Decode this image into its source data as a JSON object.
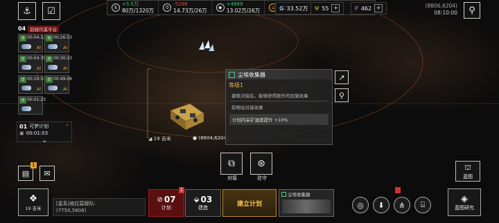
{
  "top_left_buttons": [
    {
      "name": "fleet-anchor-icon",
      "glyph": "⚓"
    },
    {
      "name": "task-list-icon",
      "glyph": "☑"
    }
  ],
  "resources": [
    {
      "icon": "credits-icon",
      "glyph": "$",
      "delta": "+5.5万",
      "delta_type": "inc",
      "amount": "80万/1320万"
    },
    {
      "icon": "metal-icon",
      "glyph": "0",
      "delta": "-5288",
      "delta_type": "dec",
      "amount": "14.73万/26万"
    },
    {
      "icon": "crystal-icon",
      "glyph": "◆",
      "delta": "+4889",
      "delta_type": "inc",
      "amount": "13.02万/26万"
    },
    {
      "icon": "fuel-icon",
      "glyph": "⌂",
      "delta": "",
      "delta_type": "",
      "amount": "121"
    }
  ],
  "resources2": [
    {
      "icon": "gas-icon",
      "glyph": "G",
      "value": "33.52万",
      "color": "#8fb3d9"
    },
    {
      "icon": "gold-icon",
      "glyph": "Ψ",
      "value": "55",
      "color": "#e0c040"
    },
    {
      "icon": "premium-icon",
      "glyph": "P",
      "value": "462",
      "color": "#b57ee0"
    }
  ],
  "coords_time": {
    "coords": "(8806,6204)",
    "time": "08:10:00"
  },
  "queue": {
    "number": "04",
    "label": "前線作業平台",
    "slots": [
      {
        "time": "00:04:13"
      },
      {
        "time": "00:26:53"
      },
      {
        "time": "00:04:39"
      },
      {
        "time": "00:30:23"
      },
      {
        "time": "00:29:53"
      },
      {
        "time": "00:49:06"
      },
      {
        "time": "00:01:23"
      }
    ],
    "slot_tag": "AI"
  },
  "plan": {
    "number": "01",
    "title": "可梦计划",
    "time": "00:01:03"
  },
  "map_labels": {
    "distance_left": "19 吉米",
    "coords_mid": "(8804,6204)"
  },
  "info_panel": {
    "title": "尘埃收集器",
    "level": "等级1",
    "desc1": "建筑对接后，能够获得额外的设施效果",
    "desc2": "前哨站对接效果",
    "effect": "计划内采矿速度提升 +10%"
  },
  "actions": [
    {
      "name": "dock-button",
      "label": "对接",
      "glyph": "⧉"
    },
    {
      "name": "garrison-button",
      "label": "驻守",
      "glyph": "⊛"
    }
  ],
  "right_side_buttons": [
    {
      "name": "share-icon",
      "glyph": "↗"
    },
    {
      "name": "pin-icon",
      "glyph": "⚲"
    }
  ],
  "blueprint_button": {
    "label": "蓝图"
  },
  "bottom": {
    "location_label": "[星系]格拉莫舰队:",
    "location_coords": "(7750,5608)",
    "distance": "19 吉米",
    "plan_count": "07",
    "plan_label": "计划",
    "build_count": "03",
    "build_label": "建造",
    "build_plan_label": "建立计划",
    "collector_label": "尘埃收集器",
    "research_label": "蓝图研究",
    "badge_plan": "1",
    "badge_mail": "1"
  },
  "bottom_icons": [
    {
      "name": "radar-icon",
      "glyph": "◎"
    },
    {
      "name": "download-icon",
      "glyph": "⬇"
    },
    {
      "name": "fleet-icon",
      "glyph": "⋔"
    },
    {
      "name": "folder-icon",
      "glyph": "⌸"
    }
  ],
  "colors": {
    "accent_gold": "#e8b040",
    "inc_green": "#36c46b",
    "dec_red": "#e04a3a",
    "plan_red": "#7a1616"
  }
}
